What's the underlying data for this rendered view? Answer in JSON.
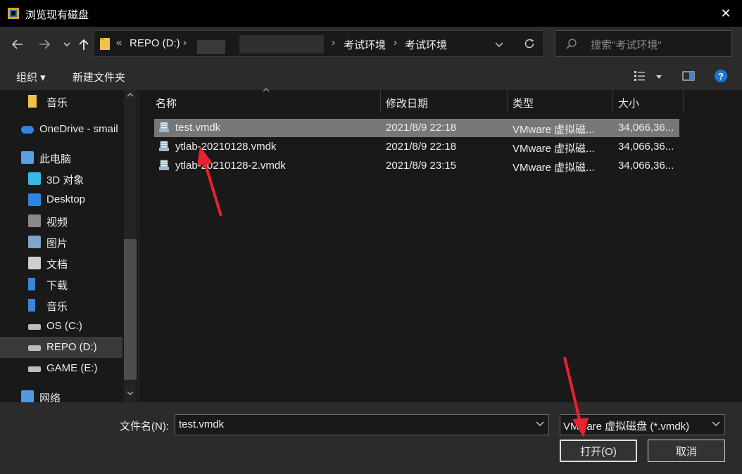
{
  "window": {
    "title": "浏览现有磁盘",
    "close_glyph": "✕"
  },
  "nav": {
    "back_icon": "arrow-left-icon",
    "forward_icon": "arrow-right-icon",
    "up_icon": "arrow-up-icon",
    "address": {
      "chevrons": "«",
      "drive": "REPO (D:)",
      "segments": [
        "考试环境",
        "考试环境"
      ]
    },
    "search_placeholder": "搜索\"考试环境\""
  },
  "toolbar": {
    "organize": "组织 ▾",
    "new_folder": "新建文件夹"
  },
  "sidebar": {
    "items": [
      {
        "label": "音乐",
        "icon": "folder-icon"
      },
      {
        "label": "OneDrive - smail",
        "icon": "cloud-icon"
      },
      {
        "label": "此电脑",
        "icon": "computer-icon"
      },
      {
        "label": "3D 对象",
        "icon": "cube-icon"
      },
      {
        "label": "Desktop",
        "icon": "desktop-icon"
      },
      {
        "label": "视频",
        "icon": "video-icon"
      },
      {
        "label": "图片",
        "icon": "picture-icon"
      },
      {
        "label": "文档",
        "icon": "document-icon"
      },
      {
        "label": "下载",
        "icon": "download-icon"
      },
      {
        "label": "音乐",
        "icon": "music-icon"
      },
      {
        "label": "OS (C:)",
        "icon": "drive-icon"
      },
      {
        "label": "REPO (D:)",
        "icon": "drive-icon"
      },
      {
        "label": "GAME (E:)",
        "icon": "drive-icon"
      },
      {
        "label": "网络",
        "icon": "network-icon"
      }
    ],
    "selected_index": 11
  },
  "files": {
    "columns": [
      "名称",
      "修改日期",
      "类型",
      "大小"
    ],
    "rows": [
      {
        "name": "test.vmdk",
        "date": "2021/8/9 22:18",
        "type": "VMware 虚拟磁...",
        "size": "34,066,36..."
      },
      {
        "name": "ytlab-20210128.vmdk",
        "date": "2021/8/9 22:18",
        "type": "VMware 虚拟磁...",
        "size": "34,066,36..."
      },
      {
        "name": "ytlab-20210128-2.vmdk",
        "date": "2021/8/9 23:15",
        "type": "VMware 虚拟磁...",
        "size": "34,066,36..."
      }
    ],
    "selected_index": 0
  },
  "bottom": {
    "filename_label": "文件名(N):",
    "filename_value": "test.vmdk",
    "filter_value": "VMware 虚拟磁盘 (*.vmdk)",
    "open_label": "打开(O)",
    "cancel_label": "取消"
  },
  "colors": {
    "annotation_arrow": "#e8222e",
    "selected_row": "#777777"
  }
}
